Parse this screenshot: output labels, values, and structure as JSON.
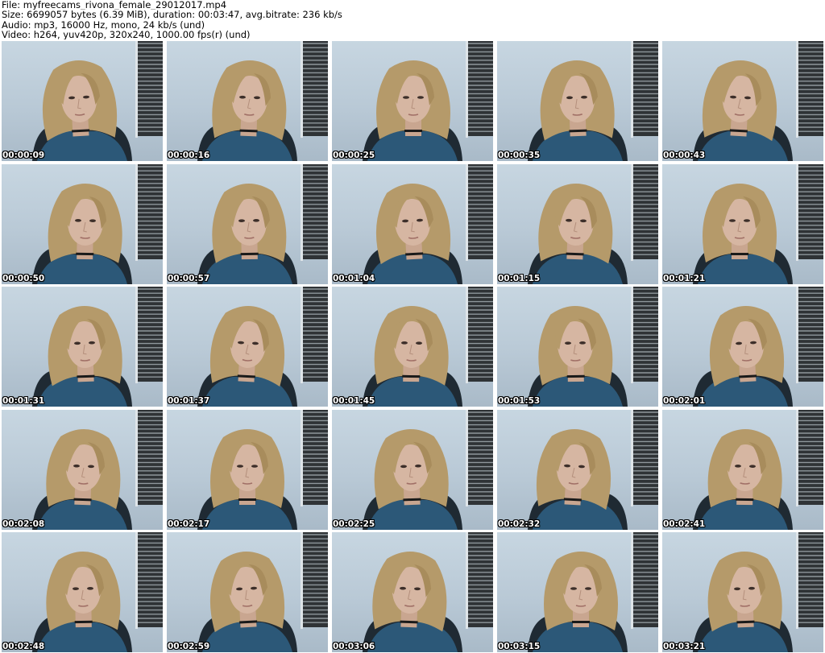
{
  "header": {
    "file_line": "File: myfreecams_rivona_female_29012017.mp4",
    "size_line": "Size: 6699057 bytes (6.39 MiB), duration: 00:03:47, avg.bitrate: 236 kb/s",
    "audio_line": "Audio: mp3, 16000 Hz, mono, 24 kb/s (und)",
    "video_line": "Video: h264, yuv420p, 320x240, 1000.00 fps(r) (und)"
  },
  "thumbnails": [
    {
      "timestamp": "00:00:09"
    },
    {
      "timestamp": "00:00:16"
    },
    {
      "timestamp": "00:00:25"
    },
    {
      "timestamp": "00:00:35"
    },
    {
      "timestamp": "00:00:43"
    },
    {
      "timestamp": "00:00:50"
    },
    {
      "timestamp": "00:00:57"
    },
    {
      "timestamp": "00:01:04"
    },
    {
      "timestamp": "00:01:15"
    },
    {
      "timestamp": "00:01:21"
    },
    {
      "timestamp": "00:01:31"
    },
    {
      "timestamp": "00:01:37"
    },
    {
      "timestamp": "00:01:45"
    },
    {
      "timestamp": "00:01:53"
    },
    {
      "timestamp": "00:02:01"
    },
    {
      "timestamp": "00:02:08"
    },
    {
      "timestamp": "00:02:17"
    },
    {
      "timestamp": "00:02:25"
    },
    {
      "timestamp": "00:02:32"
    },
    {
      "timestamp": "00:02:41"
    },
    {
      "timestamp": "00:02:48"
    },
    {
      "timestamp": "00:02:59"
    },
    {
      "timestamp": "00:03:06"
    },
    {
      "timestamp": "00:03:15"
    },
    {
      "timestamp": "00:03:21"
    }
  ],
  "colors": {
    "background": "#ffffff",
    "header_text": "#000000",
    "timestamp_text": "#ffffff",
    "timestamp_outline": "#000000",
    "wall": "#c3d3df",
    "blinds": "#2f3336",
    "hair": "#b59a6a",
    "skin": "#d6b6a2",
    "top": "#2c5878"
  }
}
